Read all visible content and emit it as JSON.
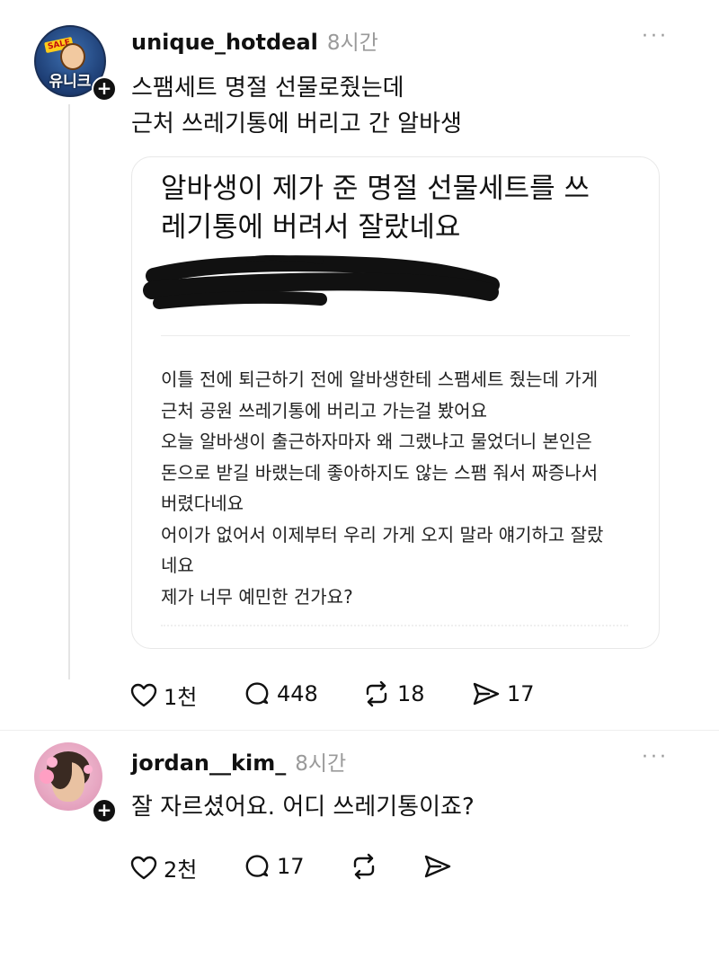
{
  "post": {
    "username": "unique_hotdeal",
    "time": "8시간",
    "more": "···",
    "avatar_text": "유니크",
    "avatar_badge": "SALE",
    "text": [
      "스팸세트 명절 선물로줬는데",
      "근처 쓰레기통에 버리고 간 알바생"
    ],
    "card": {
      "title": [
        "알바생이 제가 준 명절 선물세트를 쓰",
        "레기통에 버려서 잘랐네요"
      ],
      "body": [
        "이틀 전에 퇴근하기 전에 알바생한테 스팸세트 줬는데 가게",
        "근처 공원 쓰레기통에 버리고 가는걸 봤어요",
        "오늘 알바생이 출근하자마자 왜 그랬냐고 물었더니 본인은",
        "돈으로 받길 바랬는데 좋아하지도 않는 스팸 줘서 짜증나서",
        "버렸다네요",
        "어이가 없어서 이제부터 우리 가게 오지 말라 얘기하고 잘랐",
        "네요",
        "제가 너무 예민한 건가요?"
      ]
    },
    "stats": {
      "likes": "1천",
      "comments": "448",
      "reposts": "18",
      "shares": "17"
    }
  },
  "reply": {
    "username": "jordan__kim_",
    "time": "8시간",
    "more": "···",
    "text": "잘 자르셨어요. 어디 쓰레기통이죠?",
    "stats": {
      "likes": "2천",
      "comments": "17"
    }
  },
  "colors": {
    "text": "#111111",
    "muted": "#9a9a9a",
    "border": "#e8e8e8"
  },
  "icons": [
    "plus-icon",
    "heart-icon",
    "comment-icon",
    "repost-icon",
    "share-icon",
    "more-icon"
  ]
}
